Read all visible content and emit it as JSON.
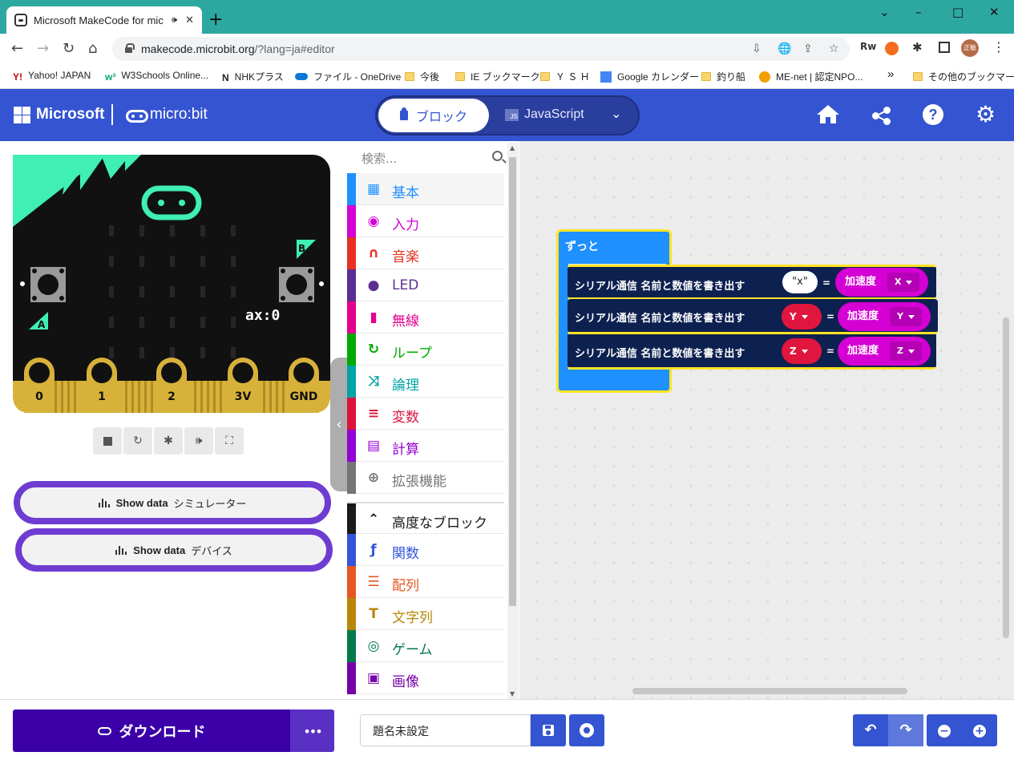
{
  "browser": {
    "tab_title": "Microsoft MakeCode for mic",
    "url_main": "makecode.microbit.org",
    "url_rest": "/?lang=ja#editor",
    "bookmarks": [
      {
        "label": "Yahoo! JAPAN",
        "icon": "yahoo-icon"
      },
      {
        "label": "W3Schools Online...",
        "icon": "w3schools-icon"
      },
      {
        "label": "NHKプラス",
        "icon": "nhk-icon"
      },
      {
        "label": "ファイル - OneDrive",
        "icon": "onedrive-icon"
      },
      {
        "label": "今後",
        "icon": "folder-icon"
      },
      {
        "label": "IE ブックマーク",
        "icon": "folder-icon"
      },
      {
        "label": "Ｙ Ｓ Ｈ",
        "icon": "folder-icon"
      },
      {
        "label": "Google カレンダー",
        "icon": "calendar-icon"
      },
      {
        "label": "釣り船",
        "icon": "folder-icon"
      },
      {
        "label": "ME-net | 認定NPO...",
        "icon": "menet-icon"
      }
    ],
    "bookmarks_overflow": "»",
    "other_bookmarks": "その他のブックマーク",
    "profile_initials": "正敏"
  },
  "header": {
    "brand": "Microsoft",
    "product": "micro:bit",
    "mode_blocks": "ブロック",
    "mode_js": "JavaScript",
    "js_badge": "JS"
  },
  "simulator": {
    "readout": "ax:0",
    "btn_a": "A",
    "btn_b": "B",
    "pins": [
      "0",
      "1",
      "2",
      "3V",
      "GND"
    ],
    "show_data_sim_bold": "Show data",
    "show_data_sim_rest": "シミュレーター",
    "show_data_dev_bold": "Show data",
    "show_data_dev_rest": "デバイス"
  },
  "toolbox": {
    "search_placeholder": "検索...",
    "categories": [
      {
        "label": "基本",
        "color": "#1e90ff",
        "icon": "grid-icon"
      },
      {
        "label": "入力",
        "color": "#d400d4",
        "icon": "circle-dot-icon"
      },
      {
        "label": "音楽",
        "color": "#e63022",
        "icon": "headphones-icon"
      },
      {
        "label": "LED",
        "color": "#5c2d91",
        "icon": "toggle-icon"
      },
      {
        "label": "無線",
        "color": "#e3008c",
        "icon": "signal-icon"
      },
      {
        "label": "ループ",
        "color": "#00aa00",
        "icon": "refresh-icon"
      },
      {
        "label": "論理",
        "color": "#00a4a6",
        "icon": "shuffle-icon"
      },
      {
        "label": "変数",
        "color": "#dc143c",
        "icon": "lines-icon"
      },
      {
        "label": "計算",
        "color": "#9400d3",
        "icon": "calculator-icon"
      },
      {
        "label": "拡張機能",
        "color": "#757575",
        "icon": "plus-circle-icon"
      },
      {
        "label": "高度なブロック",
        "color": "#1a1a1a",
        "icon": "chevron-up-icon"
      },
      {
        "label": "関数",
        "color": "#3455db",
        "icon": "function-icon"
      },
      {
        "label": "配列",
        "color": "#e65722",
        "icon": "list-icon"
      },
      {
        "label": "文字列",
        "color": "#b8860b",
        "icon": "text-icon"
      },
      {
        "label": "ゲーム",
        "color": "#007a4b",
        "icon": "gamepad-icon"
      },
      {
        "label": "画像",
        "color": "#7600a8",
        "icon": "image-icon"
      }
    ]
  },
  "workspace": {
    "forever_label": "ずっと",
    "serial_label": "シリアル通信  名前と数値を書き出す",
    "rows": [
      {
        "name_value": "\"x\"",
        "var": "",
        "accel": "加速度",
        "axis": "X"
      },
      {
        "name_value": "",
        "var": "Y",
        "accel": "加速度",
        "axis": "Y"
      },
      {
        "name_value": "",
        "var": "Z",
        "accel": "加速度",
        "axis": "Z"
      }
    ],
    "eq": "="
  },
  "bottom": {
    "download_label": "ダウンロード",
    "more_label": "•••",
    "project_name": "題名未設定"
  }
}
